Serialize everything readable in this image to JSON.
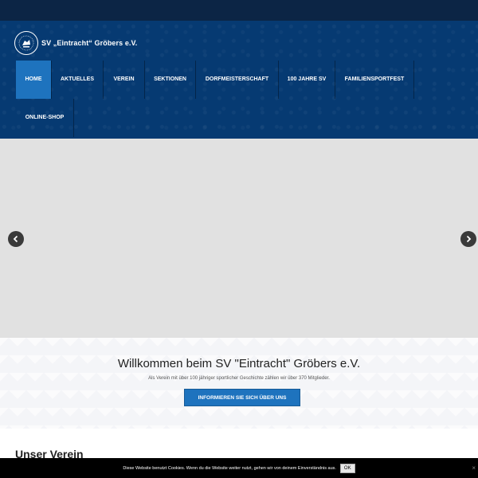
{
  "site": {
    "name": "SV „Eintracht“ Gröbers e.V."
  },
  "nav": {
    "items": [
      {
        "label": "Home",
        "active": true
      },
      {
        "label": "Aktuelles"
      },
      {
        "label": "Verein"
      },
      {
        "label": "Sektionen"
      },
      {
        "label": "Dorfmeisterschaft"
      },
      {
        "label": "100 Jahre SV"
      },
      {
        "label": "Familiensportfest"
      },
      {
        "label": "Online-Shop"
      }
    ]
  },
  "slider": {
    "prev_icon": "chevron-left-icon",
    "next_icon": "chevron-right-icon"
  },
  "welcome": {
    "title": "Willkommen beim SV \"Eintracht\" Gröbers e.V.",
    "subtitle": "Als Verein mit über 100 jähriger sportlicher Geschichte zählen wir über 370 Mitglieder.",
    "button": "Informieren Sie sich über uns"
  },
  "section": {
    "title": "Unser Verein"
  },
  "cookie": {
    "text": "Diese Website benutzt Cookies. Wenn du die Website weiter nutzt, gehen wir von deinem Einverständnis aus.",
    "ok": "OK",
    "close": "×"
  },
  "colors": {
    "header": "#063a72",
    "topbar": "#0c2545",
    "accent": "#1e73be"
  }
}
